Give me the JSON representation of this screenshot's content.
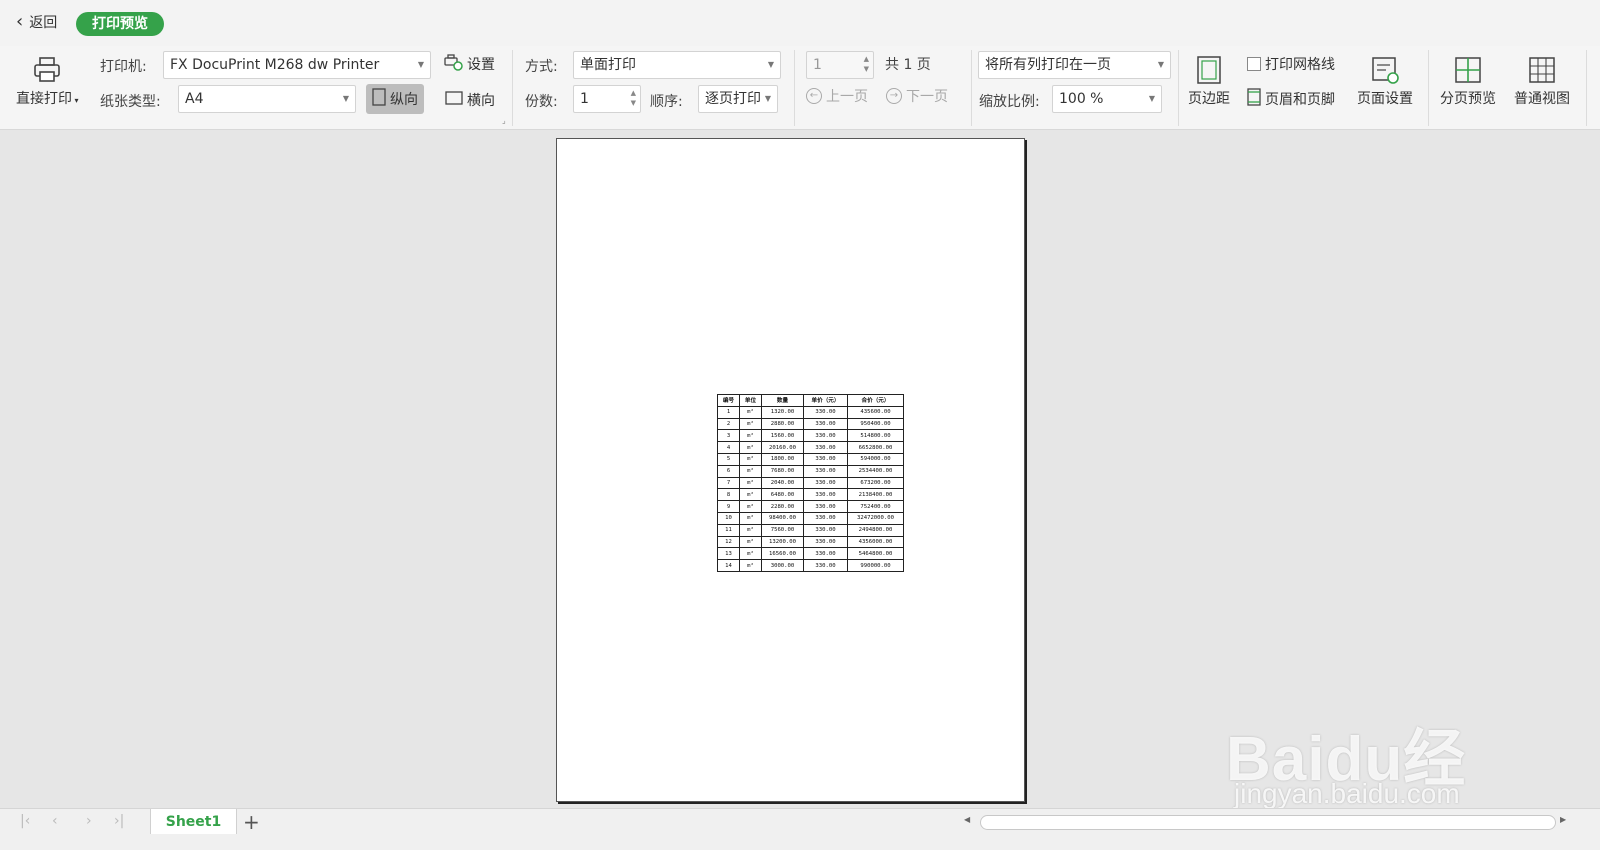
{
  "topbar": {
    "back_label": "返回",
    "mode_label": "打印预览"
  },
  "print": {
    "direct_print_label": "直接打印",
    "printer_label": "打印机:",
    "printer_value": "FX DocuPrint M268 dw Printer",
    "settings_label": "设置",
    "paper_label": "纸张类型:",
    "paper_value": "A4",
    "portrait_label": "纵向",
    "landscape_label": "横向"
  },
  "mode": {
    "method_label": "方式:",
    "method_value": "单面打印",
    "copies_label": "份数:",
    "copies_value": "1",
    "order_label": "顺序:",
    "order_value": "逐页打印"
  },
  "pagenav": {
    "page_value": "1",
    "total_label": "共 1 页",
    "prev_label": "上一页",
    "next_label": "下一页"
  },
  "scale": {
    "fit_value": "将所有列打印在一页",
    "zoom_label": "缩放比例:",
    "zoom_value": "100 %"
  },
  "layout": {
    "margins_label": "页边距",
    "gridlines_label": "打印网格线",
    "header_footer_label": "页眉和页脚",
    "page_setup_label": "页面设置",
    "page_break_label": "分页预览",
    "normal_view_label": "普通视图"
  },
  "sheet_table": {
    "headers": [
      "编号",
      "单位",
      "数量",
      "单价（元）",
      "合价（元）"
    ],
    "rows": [
      [
        "1",
        "m²",
        "1320.00",
        "330.00",
        "435600.00"
      ],
      [
        "2",
        "m²",
        "2880.00",
        "330.00",
        "950400.00"
      ],
      [
        "3",
        "m²",
        "1560.00",
        "330.00",
        "514800.00"
      ],
      [
        "4",
        "m²",
        "20160.00",
        "330.00",
        "6652800.00"
      ],
      [
        "5",
        "m²",
        "1800.00",
        "330.00",
        "594000.00"
      ],
      [
        "6",
        "m²",
        "7680.00",
        "330.00",
        "2534400.00"
      ],
      [
        "7",
        "m²",
        "2040.00",
        "330.00",
        "673200.00"
      ],
      [
        "8",
        "m²",
        "6480.00",
        "330.00",
        "2138400.00"
      ],
      [
        "9",
        "m²",
        "2280.00",
        "330.00",
        "752400.00"
      ],
      [
        "10",
        "m²",
        "98400.00",
        "330.00",
        "32472000.00"
      ],
      [
        "11",
        "m²",
        "7560.00",
        "330.00",
        "2494800.00"
      ],
      [
        "12",
        "m²",
        "13200.00",
        "330.00",
        "4356000.00"
      ],
      [
        "13",
        "m²",
        "16560.00",
        "330.00",
        "5464800.00"
      ],
      [
        "14",
        "m²",
        "3000.00",
        "330.00",
        "990000.00"
      ]
    ]
  },
  "tabs": {
    "sheet_name": "Sheet1"
  },
  "watermark": {
    "text": "Baidu经验",
    "subtext": "jingyan.baidu.com"
  },
  "colors": {
    "accent": "#35a24a"
  }
}
